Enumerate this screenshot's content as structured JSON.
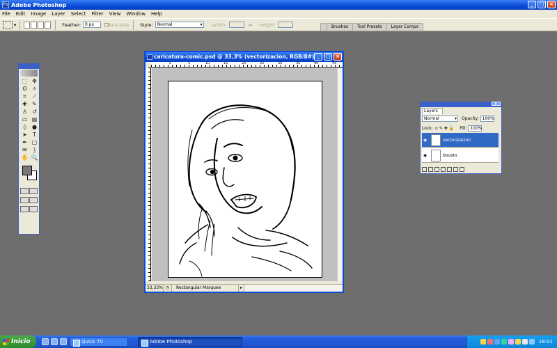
{
  "app": {
    "title": "Adobe Photoshop"
  },
  "menu": [
    "File",
    "Edit",
    "Image",
    "Layer",
    "Select",
    "Filter",
    "View",
    "Window",
    "Help"
  ],
  "options": {
    "feather_label": "Feather:",
    "feather_value": "0 px",
    "antialias_label": "Anti-alias",
    "style_label": "Style:",
    "style_value": "Normal",
    "width_label": "Width:",
    "height_label": "Height:"
  },
  "palette_well": [
    "Brushes",
    "Tool Presets",
    "Layer Comps"
  ],
  "document": {
    "title": "caricatura-comic.psd @ 33,3% (vectorizacion, RGB/8#)",
    "zoom": "33,33%",
    "status_tool": "Rectangular Marquee",
    "ruler_marks": [
      "0",
      "5",
      "10",
      "15",
      "20",
      "25",
      "30",
      "35",
      "40",
      "45"
    ]
  },
  "layers_panel": {
    "tab": "Layers",
    "blend_mode": "Normal",
    "opacity_label": "Opacity:",
    "opacity_value": "100%",
    "lock_label": "Lock:",
    "fill_label": "Fill:",
    "fill_value": "100%",
    "items": [
      {
        "name": "vectorizacion",
        "active": true
      },
      {
        "name": "boceto",
        "active": false
      }
    ]
  },
  "taskbar": {
    "start_label": "Inicio",
    "buttons": [
      "Quick TV",
      "Adobe Photoshop"
    ],
    "clock": "18:01"
  },
  "colors": {
    "titlebar": "#0a4bd8",
    "workspace": "#6e6e6e",
    "selection": "#316ac5"
  }
}
